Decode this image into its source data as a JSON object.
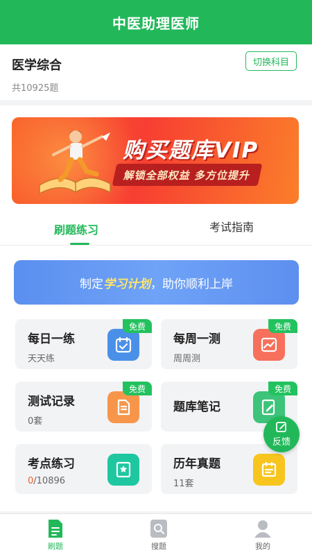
{
  "header": {
    "title": "中医助理医师"
  },
  "subject": {
    "name": "医学综合",
    "count": "共10925题",
    "switch_label": "切换科目"
  },
  "banner": {
    "title": "购买题库VIP",
    "subtitle": "解锁全部权益 多方位提升"
  },
  "tabs": [
    {
      "label": "刷题练习",
      "active": true
    },
    {
      "label": "考试指南",
      "active": false
    }
  ],
  "plan": {
    "prefix": "制定",
    "highlight": "学习计划",
    "suffix": "，助你顺利上岸"
  },
  "cards": [
    {
      "title": "每日一练",
      "sub": "天天练",
      "badge": "免费",
      "icon": "calendar-check-icon",
      "color": "#4a90e8"
    },
    {
      "title": "每周一测",
      "sub": "周周测",
      "badge": "免费",
      "icon": "chart-image-icon",
      "color": "#f7705c"
    },
    {
      "title": "测试记录",
      "sub": "0套",
      "badge": "免费",
      "icon": "document-icon",
      "color": "#f7964a"
    },
    {
      "title": "题库笔记",
      "sub": "",
      "badge": "免费",
      "icon": "notebook-pen-icon",
      "color": "#3dc47a"
    },
    {
      "title": "考点练习",
      "sub_done": "0",
      "sub_total": "/10896",
      "badge": "",
      "icon": "star-book-icon",
      "color": "#1fc7a0"
    },
    {
      "title": "历年真题",
      "sub": "11套",
      "badge": "",
      "icon": "exam-paper-icon",
      "color": "#f7c51e"
    }
  ],
  "feedback": {
    "label": "反馈"
  },
  "bottom_nav": [
    {
      "label": "刷题",
      "icon": "practice-icon",
      "active": true
    },
    {
      "label": "搜题",
      "icon": "search-icon",
      "active": false
    },
    {
      "label": "我的",
      "icon": "user-icon",
      "active": false
    }
  ],
  "colors": {
    "brand": "#22b85a",
    "accent_orange": "#f25a2e",
    "plan_blue": "#6297f2"
  }
}
